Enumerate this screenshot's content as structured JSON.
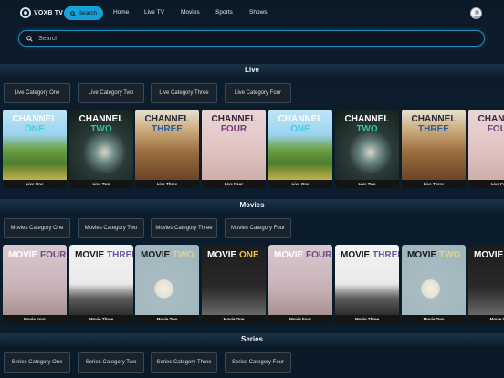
{
  "app": {
    "logo_text": "VOXB TV"
  },
  "nav": {
    "search_label": "Search",
    "links": [
      "Home",
      "Live TV",
      "Movies",
      "Sports",
      "Shows"
    ]
  },
  "search": {
    "placeholder": "Search"
  },
  "sections": {
    "live": {
      "title": "Live",
      "categories": [
        "Live Category One",
        "Live Category Two",
        "Live Category Three",
        "Live Category Four"
      ],
      "cards": [
        {
          "w1": "CHANNEL",
          "w2": "ONE",
          "caption": "Live One",
          "theme": "one"
        },
        {
          "w1": "CHANNEL",
          "w2": "TWO",
          "caption": "Live Two",
          "theme": "two"
        },
        {
          "w1": "CHANNEL",
          "w2": "THREE",
          "caption": "Live Three",
          "theme": "three"
        },
        {
          "w1": "CHANNEL",
          "w2": "FOUR",
          "caption": "Live Four",
          "theme": "four"
        },
        {
          "w1": "CHANNEL",
          "w2": "ONE",
          "caption": "Live One",
          "theme": "one"
        },
        {
          "w1": "CHANNEL",
          "w2": "TWO",
          "caption": "Live Two",
          "theme": "two"
        },
        {
          "w1": "CHANNEL",
          "w2": "THREE",
          "caption": "Live Three",
          "theme": "three"
        },
        {
          "w1": "CHANNEL",
          "w2": "FOUR",
          "caption": "Live Four",
          "theme": "four"
        }
      ]
    },
    "movies": {
      "title": "Movies",
      "categories": [
        "Movies Category One",
        "Movies Category Two",
        "Movies Category Three",
        "Movies Category Four"
      ],
      "cards": [
        {
          "w1": "MOVIE",
          "w2": "FOUR",
          "caption": "Movie Four",
          "theme": "mfour"
        },
        {
          "w1": "MOVIE",
          "w2": "THREE",
          "caption": "Movie Three",
          "theme": "mthree"
        },
        {
          "w1": "MOVIE",
          "w2": "TWO",
          "caption": "Movie Two",
          "theme": "mtwo"
        },
        {
          "w1": "MOVIE",
          "w2": "ONE",
          "caption": "Movie One",
          "theme": "mone"
        },
        {
          "w1": "MOVIE",
          "w2": "FOUR",
          "caption": "Movie Four",
          "theme": "mfour"
        },
        {
          "w1": "MOVIE",
          "w2": "THREE",
          "caption": "Movie Three",
          "theme": "mthree"
        },
        {
          "w1": "MOVIE",
          "w2": "TWO",
          "caption": "Movie Two",
          "theme": "mtwo"
        },
        {
          "w1": "MOVIE",
          "w2": "ONE",
          "caption": "Movie One",
          "theme": "mone"
        }
      ]
    },
    "series": {
      "title": "Series",
      "categories": [
        "Series Category One",
        "Series Category Two",
        "Series Category Three",
        "Series Category Four"
      ]
    }
  },
  "colors": {
    "accent": "#14a3d8",
    "channel_one": "#3fd0e8",
    "channel_two": "#2ec4a8",
    "channel_three": "#2a5a9a",
    "channel_four": "#7a3a7a",
    "movie_four": "#6e4a86",
    "movie_three": "#6a5aa8",
    "movie_two": "#e0d48a",
    "movie_one": "#f0c040"
  }
}
